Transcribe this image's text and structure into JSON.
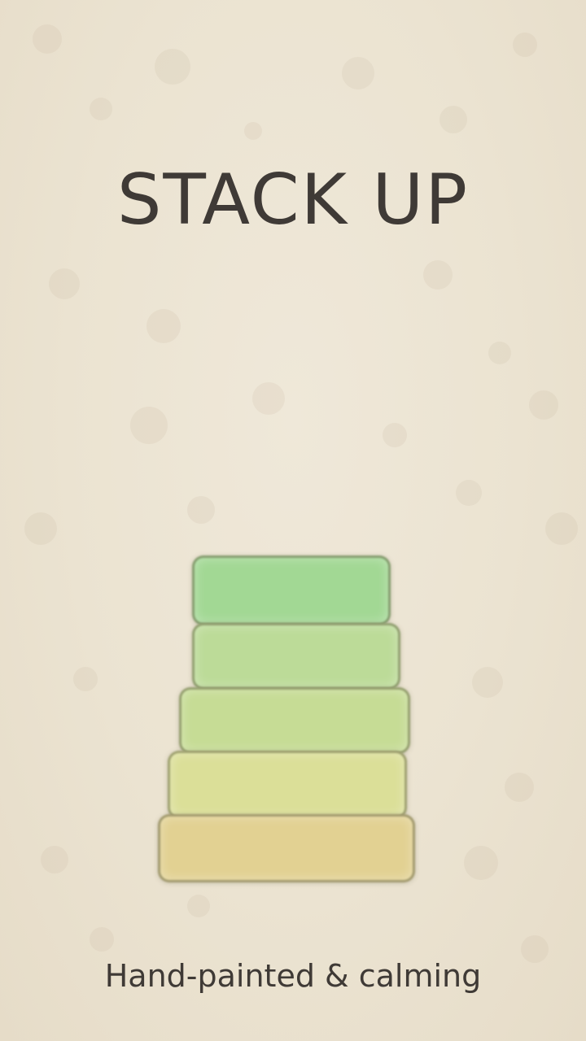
{
  "game": {
    "title": "STACK UP",
    "tagline": "Hand-painted & calming"
  },
  "colors": {
    "background": "#ebe3d1",
    "text": "#3f3a36",
    "blocks": [
      "#a2d894",
      "#bcdb98",
      "#c6dc95",
      "#dbdf98",
      "#e2d192"
    ]
  },
  "stack": {
    "block_count": 5
  }
}
